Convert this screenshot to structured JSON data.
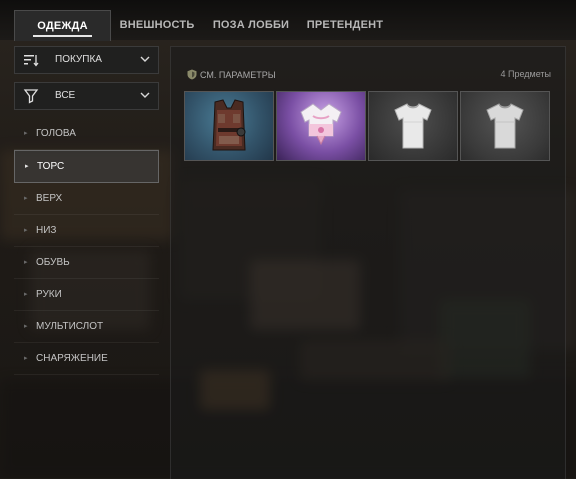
{
  "tabs": [
    {
      "label": "ОДЕЖДА",
      "active": true
    },
    {
      "label": "ВНЕШНОСТЬ",
      "active": false
    },
    {
      "label": "ПОЗА ЛОББИ",
      "active": false
    },
    {
      "label": "ПРЕТЕНДЕНТ",
      "active": false
    }
  ],
  "sidebar": {
    "sort_dropdown": {
      "label": "ПОКУПКА",
      "icon": "sort-icon"
    },
    "filter_dropdown": {
      "label": "ВСЕ",
      "icon": "filter-icon"
    },
    "categories": [
      {
        "label": "ГОЛОВА",
        "active": false
      },
      {
        "label": "ТОРС",
        "active": true
      },
      {
        "label": "ВЕРХ",
        "active": false
      },
      {
        "label": "НИЗ",
        "active": false
      },
      {
        "label": "ОБУВЬ",
        "active": false
      },
      {
        "label": "РУКИ",
        "active": false
      },
      {
        "label": "МУЛЬТИСЛОТ",
        "active": false
      },
      {
        "label": "СНАРЯЖЕНИЕ",
        "active": false
      }
    ]
  },
  "main": {
    "params_label": "СМ. ПАРАМЕТРЫ",
    "item_count": "4 Предметы",
    "items": [
      {
        "name": "vest-item",
        "icon": "vest-icon",
        "bg": "#3f6a82"
      },
      {
        "name": "pink-top-item",
        "icon": "tied-shirt-icon",
        "bg": "#8b5db8"
      },
      {
        "name": "white-tshirt-item",
        "icon": "tshirt-icon",
        "bg": "#3c3c3c"
      },
      {
        "name": "gray-tshirt-item",
        "icon": "tshirt-icon",
        "bg": "#3f3f3f"
      }
    ]
  }
}
